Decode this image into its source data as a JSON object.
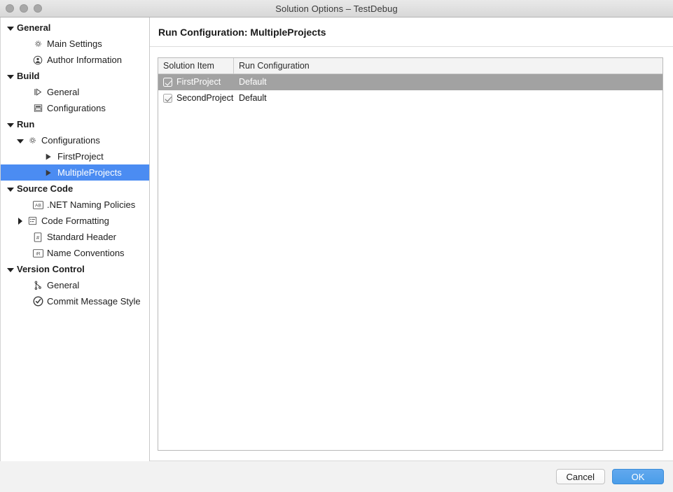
{
  "window": {
    "title": "Solution Options – TestDebug",
    "traffic_lights": [
      "close",
      "minimize",
      "zoom"
    ]
  },
  "sidebar": {
    "items": [
      {
        "label": "General",
        "level": 0,
        "twisty": "down",
        "icon": null,
        "bold": true,
        "selected": false
      },
      {
        "label": "Main Settings",
        "level": 1,
        "twisty": null,
        "icon": "gear-icon",
        "bold": false,
        "selected": false
      },
      {
        "label": "Author Information",
        "level": 1,
        "twisty": null,
        "icon": "person-icon",
        "bold": false,
        "selected": false
      },
      {
        "label": "Build",
        "level": 0,
        "twisty": "down",
        "icon": null,
        "bold": true,
        "selected": false
      },
      {
        "label": "General",
        "level": 1,
        "twisty": null,
        "icon": "build-icon",
        "bold": false,
        "selected": false
      },
      {
        "label": "Configurations",
        "level": 1,
        "twisty": null,
        "icon": "window-icon",
        "bold": false,
        "selected": false
      },
      {
        "label": "Run",
        "level": 0,
        "twisty": "down",
        "icon": null,
        "bold": true,
        "selected": false
      },
      {
        "label": "Configurations",
        "level": 2,
        "twisty": "down",
        "icon": "gear-icon",
        "bold": false,
        "selected": false
      },
      {
        "label": "FirstProject",
        "level": 3,
        "twisty": null,
        "icon": "play-icon",
        "bold": false,
        "selected": false
      },
      {
        "label": "MultipleProjects",
        "level": 3,
        "twisty": null,
        "icon": "play-icon",
        "bold": false,
        "selected": true
      },
      {
        "label": "Source Code",
        "level": 0,
        "twisty": "down",
        "icon": null,
        "bold": true,
        "selected": false
      },
      {
        "label": ".NET Naming Policies",
        "level": 1,
        "twisty": null,
        "icon": "ab-icon",
        "bold": false,
        "selected": false
      },
      {
        "label": "Code Formatting",
        "level": 2,
        "twisty": "right",
        "icon": "list-icon",
        "bold": false,
        "selected": false
      },
      {
        "label": "Standard Header",
        "level": 1,
        "twisty": null,
        "icon": "hash-doc-icon",
        "bold": false,
        "selected": false
      },
      {
        "label": "Name Conventions",
        "level": 1,
        "twisty": null,
        "icon": "ir-icon",
        "bold": false,
        "selected": false
      },
      {
        "label": "Version Control",
        "level": 0,
        "twisty": "down",
        "icon": null,
        "bold": true,
        "selected": false
      },
      {
        "label": "General",
        "level": 1,
        "twisty": null,
        "icon": "branch-icon",
        "bold": false,
        "selected": false
      },
      {
        "label": "Commit Message Style",
        "level": 1,
        "twisty": null,
        "icon": "check-circle-icon",
        "bold": false,
        "selected": false
      }
    ]
  },
  "content": {
    "title": "Run Configuration: MultipleProjects",
    "table": {
      "columns": [
        "Solution Item",
        "Run Configuration"
      ],
      "rows": [
        {
          "checked": true,
          "name": "FirstProject",
          "configuration": "Default",
          "selected": true
        },
        {
          "checked": true,
          "name": "SecondProject",
          "configuration": "Default",
          "selected": false
        }
      ]
    }
  },
  "footer": {
    "cancel_label": "Cancel",
    "ok_label": "OK"
  },
  "colors": {
    "selection_blue": "#4b8cf2",
    "row_selection_gray": "#a2a2a2",
    "ok_button_blue": "#4a9de9"
  }
}
